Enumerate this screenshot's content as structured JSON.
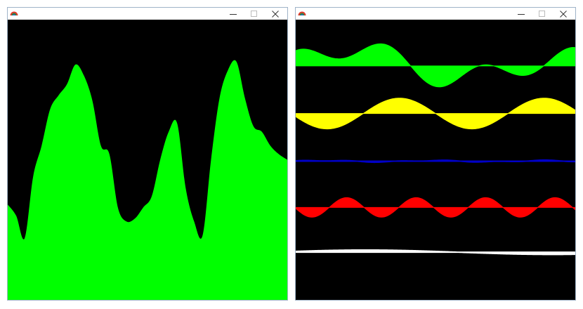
{
  "windows": [
    {
      "id": "left",
      "controls": [
        "minimize-icon",
        "maximize-icon",
        "close-icon"
      ],
      "plot": {
        "background": "#000000",
        "fill_color": "#00ff00",
        "description_samples": [
          0.34,
          0.3,
          0.22,
          0.44,
          0.55,
          0.68,
          0.73,
          0.77,
          0.84,
          0.8,
          0.71,
          0.55,
          0.52,
          0.33,
          0.28,
          0.29,
          0.33,
          0.37,
          0.5,
          0.6,
          0.63,
          0.4,
          0.28,
          0.23,
          0.5,
          0.72,
          0.82,
          0.85,
          0.72,
          0.62,
          0.6,
          0.55,
          0.52,
          0.5
        ]
      }
    },
    {
      "id": "right",
      "controls": [
        "minimize-icon",
        "maximize-icon",
        "close-icon"
      ],
      "waves": [
        {
          "color": "#00ff00",
          "baseline": 0.165,
          "amplitude": 0.09
        },
        {
          "color": "#ffff00",
          "baseline": 0.335,
          "amplitude": 0.055
        },
        {
          "color": "#0000c8",
          "baseline": 0.505,
          "amplitude": 0.004
        },
        {
          "color": "#ff0000",
          "baseline": 0.67,
          "amplitude": 0.035
        },
        {
          "color": "#ffffff",
          "baseline": 0.83,
          "amplitude": 0.008
        }
      ]
    }
  ]
}
